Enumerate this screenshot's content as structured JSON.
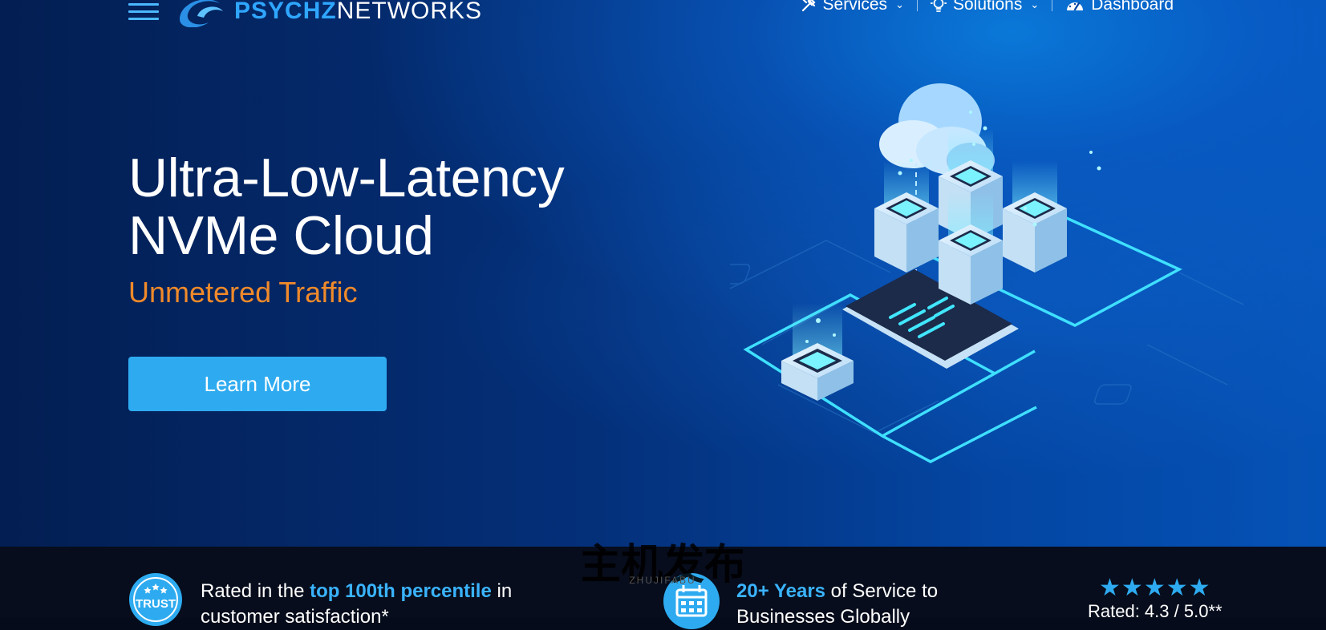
{
  "header": {
    "logo_primary": "PSYCHZ",
    "logo_secondary": "NETWORKS",
    "nav": [
      {
        "label": "Services",
        "icon": "tools-icon"
      },
      {
        "label": "Solutions",
        "icon": "lightbulb-icon"
      },
      {
        "label": "Dashboard",
        "icon": "gauge-icon"
      }
    ]
  },
  "hero": {
    "headline_line1": "Ultra-Low-Latency",
    "headline_line2": "NVMe Cloud",
    "subheadline": "Unmetered Traffic",
    "cta_label": "Learn More"
  },
  "trust_bar": {
    "badge_text": "TRUST",
    "satisfaction_prefix": "Rated in the ",
    "satisfaction_highlight": "top 100th percentile",
    "satisfaction_suffix": " in",
    "satisfaction_line2": "customer satisfaction*",
    "years_highlight": "20+ Years",
    "years_suffix": " of Service to",
    "years_line2": "Businesses Globally",
    "stars_display": "★★★★★",
    "rating_text": "Rated: 4.3 / 5.0**"
  },
  "watermark": {
    "chinese": "主机发布",
    "latin": "ZHUJIFABU"
  },
  "colors": {
    "accent": "#2eabf0",
    "orange": "#f08a2a",
    "hero_dark": "#031e52",
    "hero_light": "#0552b6"
  }
}
